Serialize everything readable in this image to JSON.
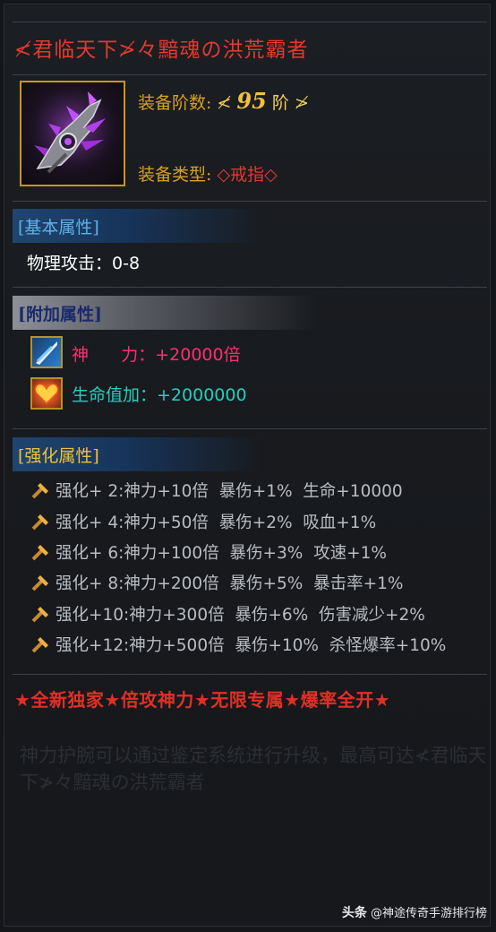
{
  "item": {
    "title": "≮君临天下≯々黯魂の洪荒霸者",
    "level_label": "装备阶数:",
    "level_open": "≮",
    "level_value": "95",
    "level_unit": "阶",
    "level_close": "≯",
    "type_label": "装备类型:",
    "type_value": "◇戒指◇",
    "icon": "purple-claw-ring-icon"
  },
  "basic": {
    "header": "[基本属性]",
    "line": "物理攻击：0-8"
  },
  "extra": {
    "header": "[附加属性]",
    "items": [
      {
        "icon": "sword-slash-icon",
        "label": "神      力：",
        "value": "+20000倍",
        "color": "#ff2e6e"
      },
      {
        "icon": "heart-icon",
        "label": "生命值加：",
        "value": "+2000000",
        "color": "#22d0c0"
      }
    ]
  },
  "enhance": {
    "header": "[强化属性]",
    "rows": [
      "强化+ 2:神力+10倍  暴伤+1%  生命+10000",
      "强化+ 4:神力+50倍  暴伤+2%  吸血+1%",
      "强化+ 6:神力+100倍  暴伤+3%  攻速+1%",
      "强化+ 8:神力+200倍  暴伤+5%  暴击率+1%",
      "强化+10:神力+300倍  暴伤+6%  伤害减少+2%",
      "强化+12:神力+500倍  暴伤+10%  杀怪爆率+10%"
    ]
  },
  "promo": "★全新独家★倍攻神力★无限专属★爆率全开★",
  "description": "神力护腕可以通过鉴定系统进行升级，最高可达≮君临天下≯々黯魂の洪荒霸者",
  "watermark": {
    "platform": "头条",
    "account": "@神途传奇手游排行榜"
  },
  "colors": {
    "title_red": "#e23a2e",
    "label_gold": "#d8a022",
    "section_blue": "#5fb0e8",
    "power_pink": "#ff2e6e",
    "life_cyan": "#22d0c0"
  }
}
